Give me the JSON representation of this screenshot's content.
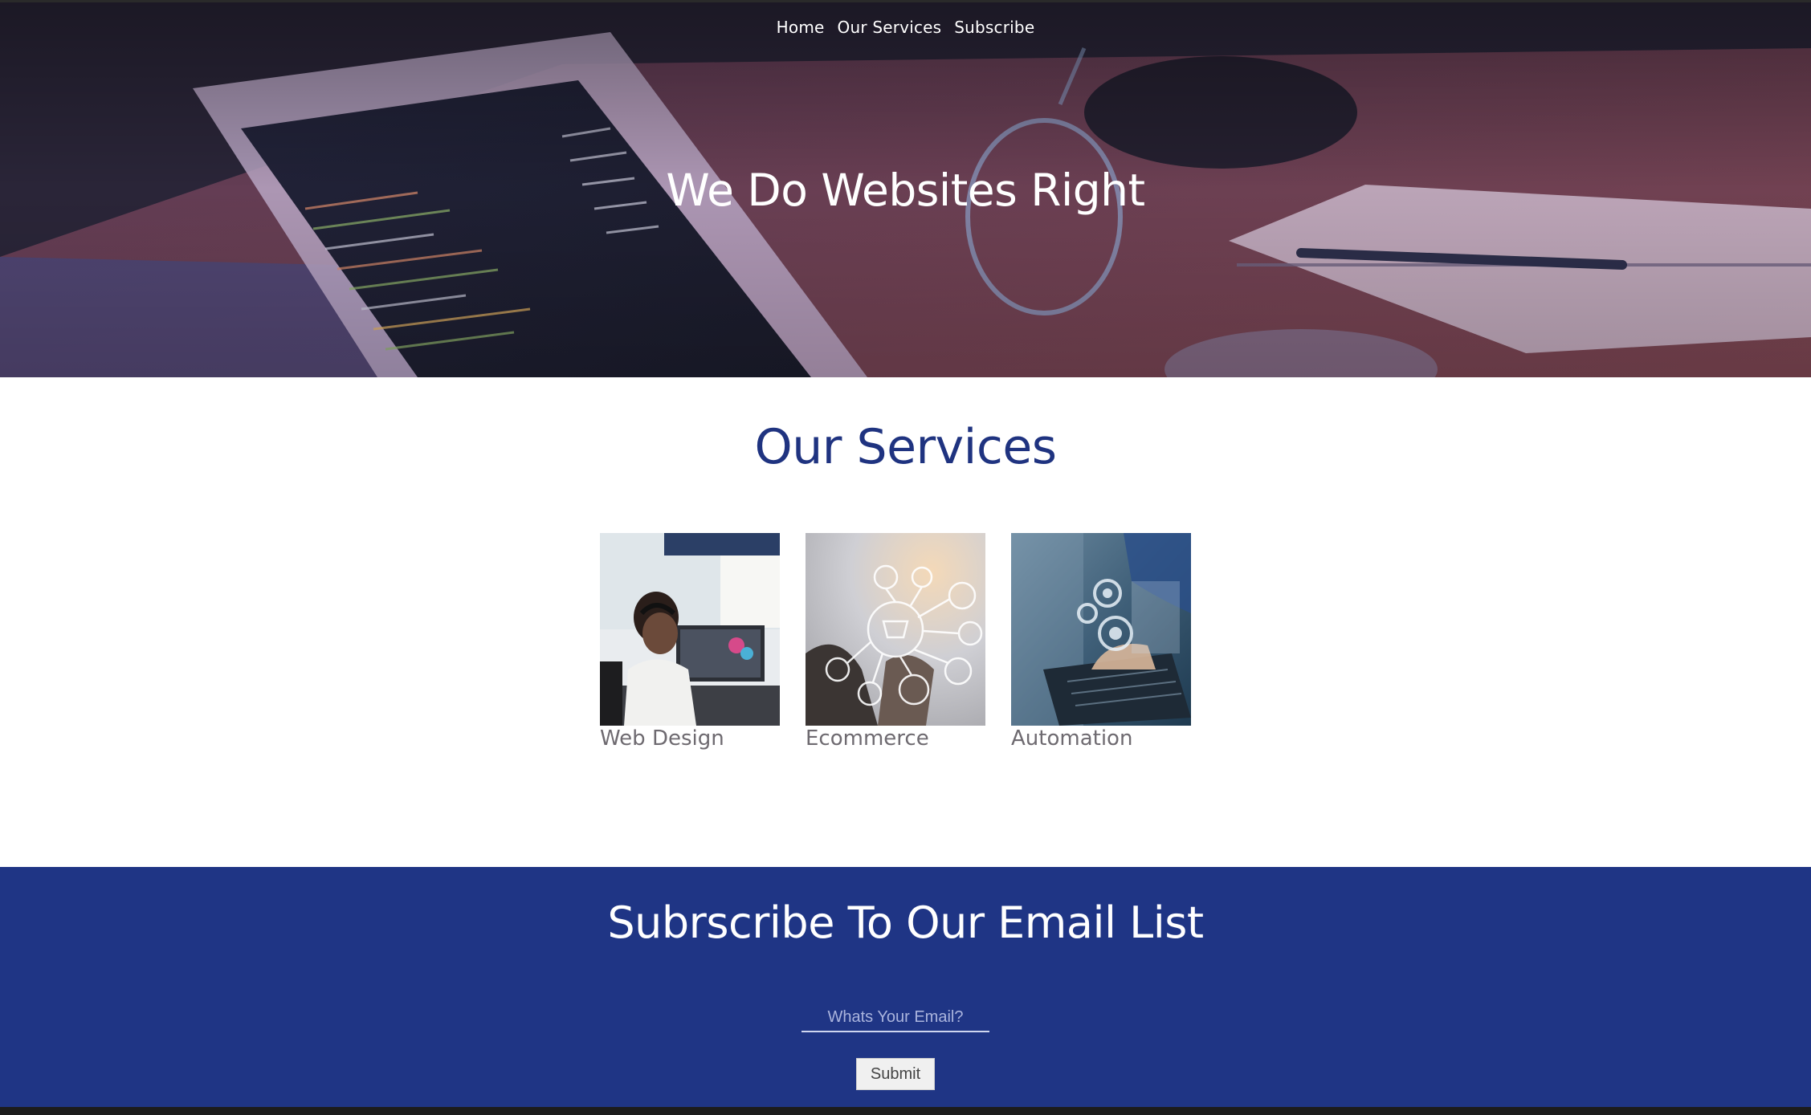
{
  "nav": {
    "items": [
      {
        "label": "Home"
      },
      {
        "label": "Our Services"
      },
      {
        "label": "Subscribe"
      }
    ]
  },
  "hero": {
    "title": "We Do Websites Right"
  },
  "services": {
    "title": "Our Services",
    "cards": [
      {
        "label": "Web Design"
      },
      {
        "label": "Ecommerce"
      },
      {
        "label": "Automation"
      }
    ]
  },
  "subscribe": {
    "title": "Subrscribe To Our Email List",
    "email_placeholder": "Whats Your Email?",
    "email_value": "",
    "submit_label": "Submit"
  },
  "colors": {
    "brand_blue": "#1f3585",
    "heading_blue": "#1f3380",
    "label_gray": "#6e6a70"
  }
}
